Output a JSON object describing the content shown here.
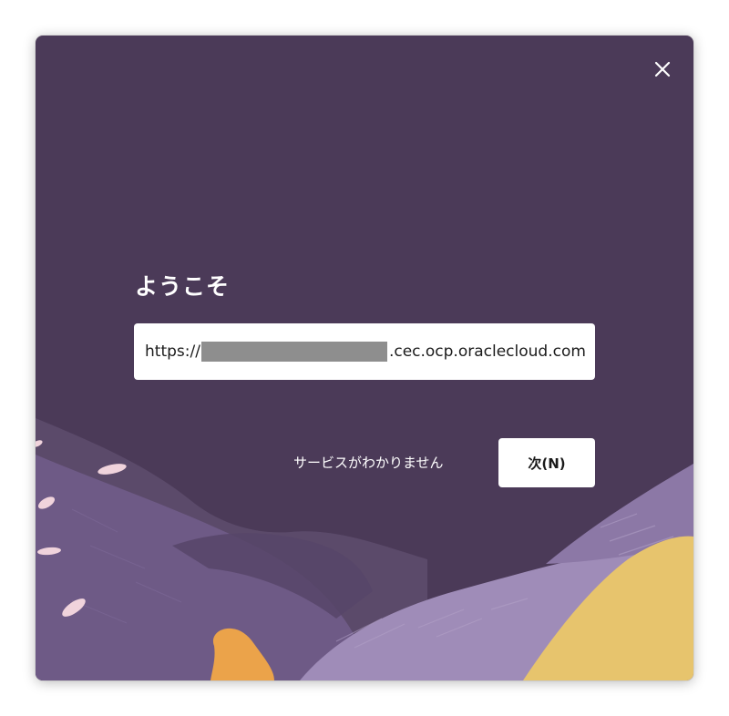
{
  "dialog": {
    "title": "ようこそ",
    "url": {
      "prefix": "https://",
      "suffix": ".cec.ocp.oraclecloud.com"
    },
    "help_link": "サービスがわかりません",
    "next_button": "次(N)",
    "close_icon": "close-icon"
  },
  "colors": {
    "background": "#4b3a58",
    "accent_yellow": "#e7c46d",
    "accent_orange": "#eba34a",
    "accent_pink": "#f0d3dc",
    "hill_light": "#9a86b2"
  }
}
